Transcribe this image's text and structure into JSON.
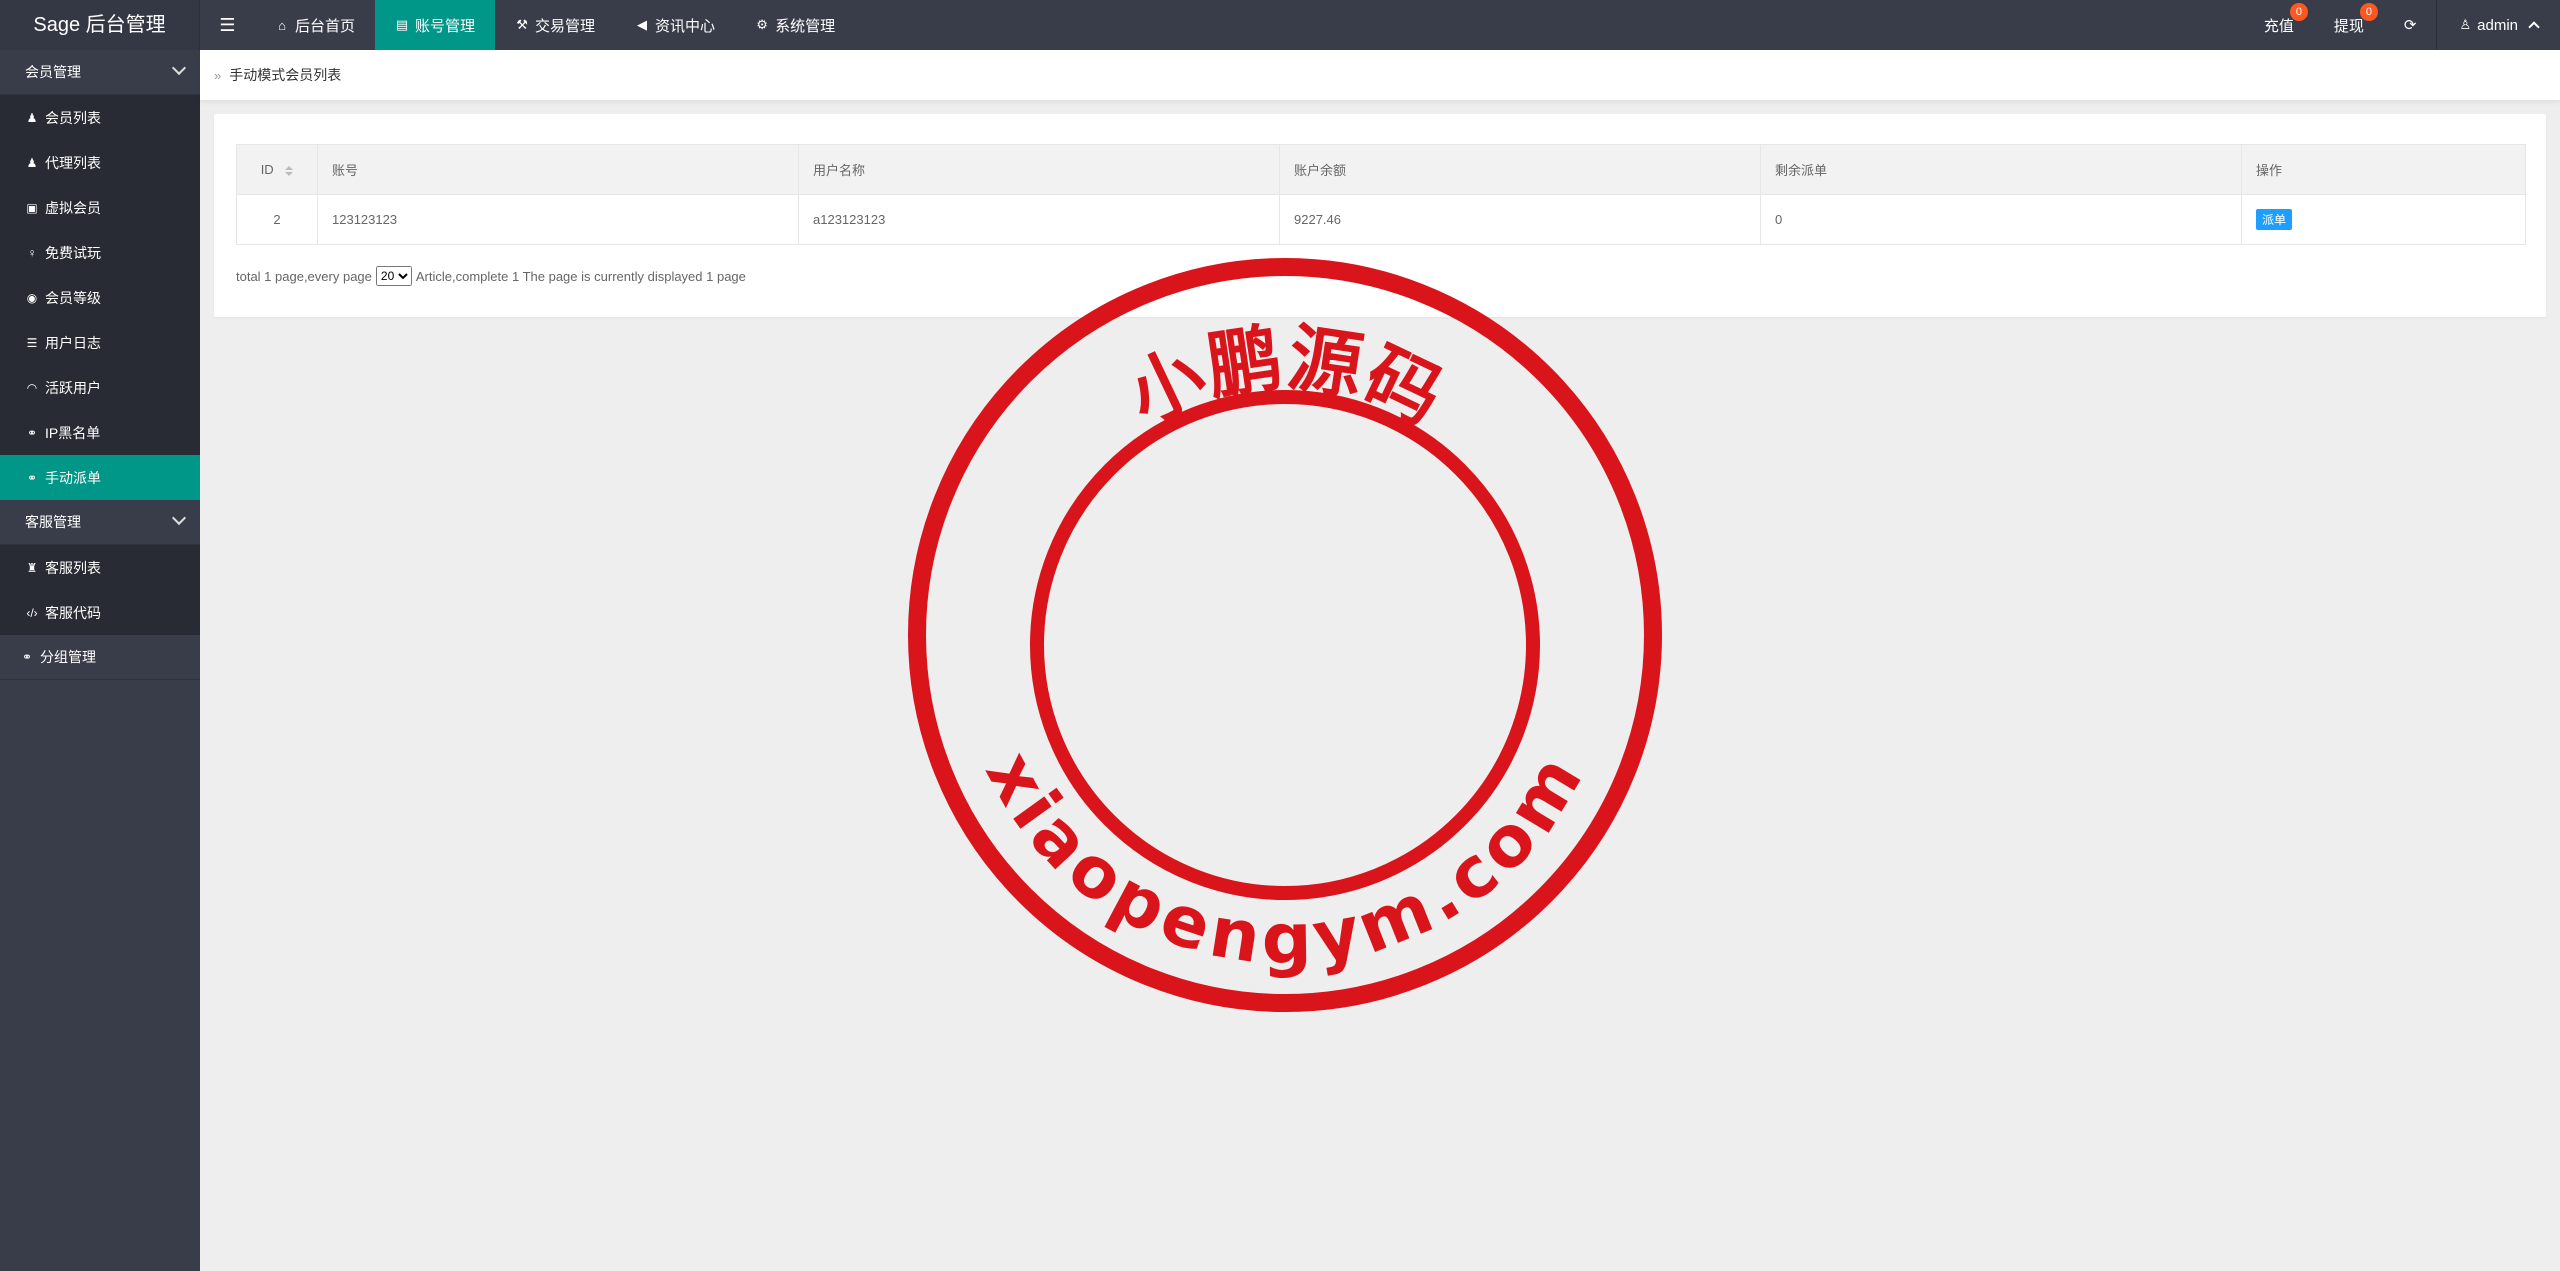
{
  "app": {
    "title": "Sage 后台管理"
  },
  "header": {
    "toggle_icon": "menu-icon",
    "nav": [
      {
        "label": "后台首页",
        "icon": "home-icon",
        "active": false
      },
      {
        "label": "账号管理",
        "icon": "id-card-icon",
        "active": true
      },
      {
        "label": "交易管理",
        "icon": "gavel-icon",
        "active": false
      },
      {
        "label": "资讯中心",
        "icon": "bullhorn-icon",
        "active": false
      },
      {
        "label": "系统管理",
        "icon": "gears-icon",
        "active": false
      }
    ],
    "recharge": {
      "label": "充值",
      "badge": "0"
    },
    "withdraw": {
      "label": "提现",
      "badge": "0"
    },
    "refresh_icon": "refresh-icon",
    "user": {
      "label": "admin",
      "icon": "user-icon"
    }
  },
  "sidebar": {
    "groups": [
      {
        "label": "会员管理",
        "items": [
          {
            "label": "会员列表",
            "icon": "user-icon"
          },
          {
            "label": "代理列表",
            "icon": "users-icon"
          },
          {
            "label": "虚拟会员",
            "icon": "lock-icon"
          },
          {
            "label": "免费试玩",
            "icon": "female-icon"
          },
          {
            "label": "会员等级",
            "icon": "gamepad-icon"
          },
          {
            "label": "用户日志",
            "icon": "list-icon"
          },
          {
            "label": "活跃用户",
            "icon": "wifi-icon"
          },
          {
            "label": "IP黑名单",
            "icon": "link-icon"
          },
          {
            "label": "手动派单",
            "icon": "link-icon",
            "active": true
          }
        ]
      },
      {
        "label": "客服管理",
        "items": [
          {
            "label": "客服列表",
            "icon": "user-secret-icon"
          },
          {
            "label": "客服代码",
            "icon": "code-icon"
          }
        ]
      }
    ],
    "single": {
      "label": "分组管理",
      "icon": "link-icon"
    }
  },
  "breadcrumb": {
    "current": "手动模式会员列表"
  },
  "table": {
    "headers": [
      "ID",
      "账号",
      "用户名称",
      "账户余额",
      "剩余派单",
      "操作"
    ],
    "rows": [
      {
        "id": "2",
        "account": "123123123",
        "username": "a123123123",
        "balance": "9227.46",
        "remaining": "0",
        "action": "派单"
      }
    ]
  },
  "pagination": {
    "prefix": "total 1 page,every page",
    "per_page": "20",
    "options": [
      "20"
    ],
    "suffix": "Article,complete 1 The page is currently displayed 1 page"
  },
  "watermark": {
    "top_text": "小鹏源码",
    "bottom_text": "xiaopengym.com",
    "color": "#d9141b"
  },
  "colors": {
    "header_bg": "#393d49",
    "accent": "#009688",
    "button": "#1e9fff",
    "badge": "#ff5722"
  }
}
